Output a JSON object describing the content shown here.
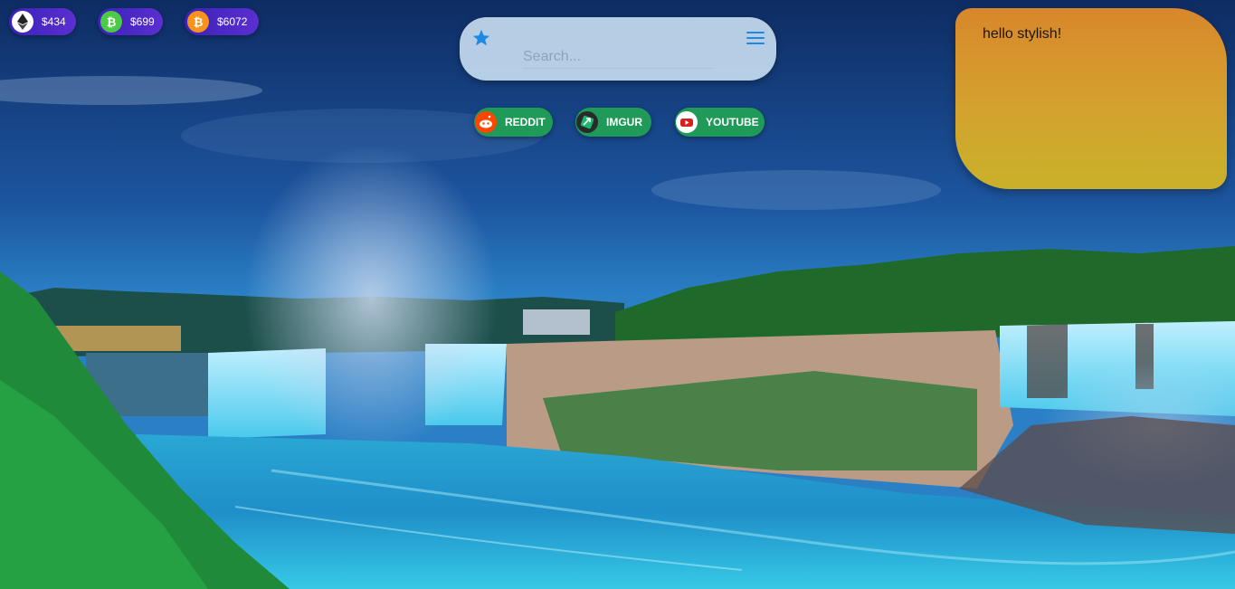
{
  "crypto": [
    {
      "id": "eth",
      "icon": "ethereum-icon",
      "price": "$434"
    },
    {
      "id": "bch",
      "icon": "bitcoin-cash-icon",
      "price": "$699"
    },
    {
      "id": "btc",
      "icon": "bitcoin-icon",
      "price": "$6072"
    }
  ],
  "search": {
    "placeholder": "Search...",
    "value": "",
    "favorite_icon": "star-icon",
    "menu_icon": "hamburger-menu-icon"
  },
  "quick_links": [
    {
      "label": "REDDIT",
      "icon": "reddit-icon"
    },
    {
      "label": "IMGUR",
      "icon": "imgur-icon"
    },
    {
      "label": "YOUTUBE",
      "icon": "youtube-icon"
    }
  ],
  "note": {
    "text": "hello stylish!"
  },
  "colors": {
    "accent": "#1e88e5",
    "link_bg": "#1f9a58",
    "chip_bg": "#4a28c4",
    "note_bg": "#d4a22e"
  }
}
